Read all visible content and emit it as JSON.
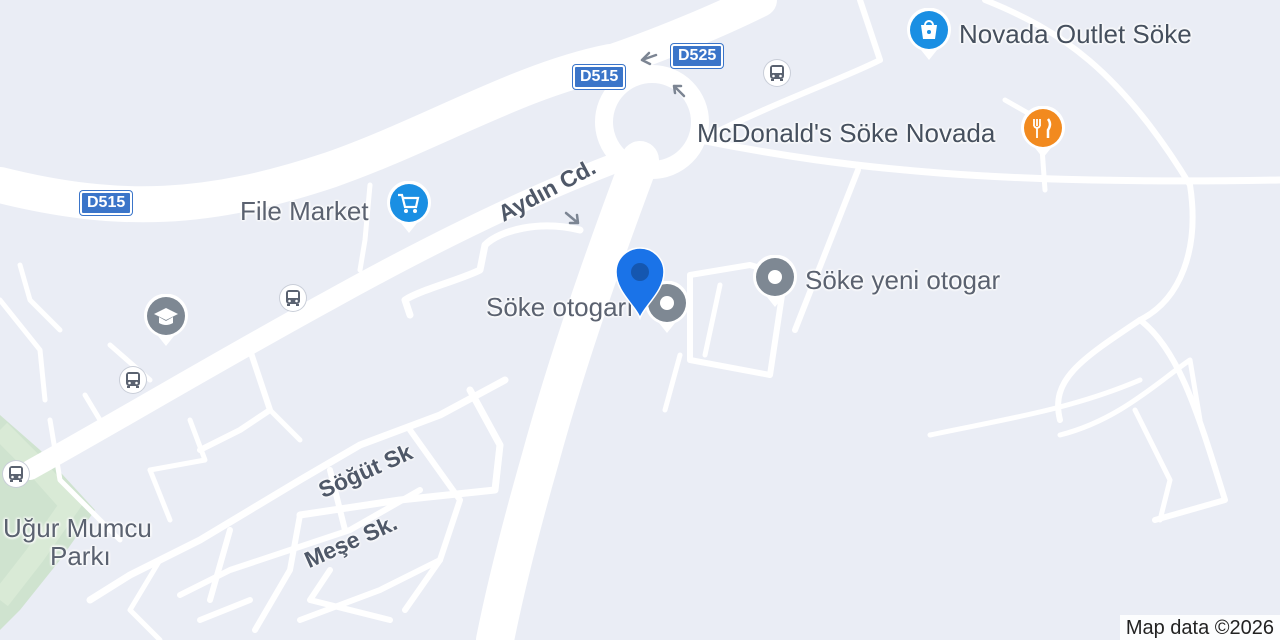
{
  "map": {
    "places": {
      "novada_outlet": "Novada Outlet Söke",
      "mcdonalds": "McDonald's Söke Novada",
      "file_market": "File Market",
      "soke_otogar": "Söke otogarı",
      "soke_yeni_otogar": "Söke yeni otogar",
      "ugur_mumcu_line1": "Uğur Mumcu",
      "ugur_mumcu_line2": "Parkı"
    },
    "roads": {
      "aydin": "Aydın Cd.",
      "sogut": "Söğüt Sk",
      "mese": "Meşe Sk."
    },
    "shields": {
      "d515_top": "D515",
      "d525": "D525",
      "d515_left": "D515"
    },
    "icons": {
      "shopping": "shopping-bag-icon",
      "restaurant": "fork-knife-icon",
      "cart": "shopping-cart-icon",
      "education": "graduation-cap-icon",
      "generic": "generic-place-icon",
      "bus": "bus-stop-icon",
      "location": "location-pin-icon"
    },
    "colors": {
      "background": "#eaedf5",
      "road": "#ffffff",
      "park": "#cfe3cf",
      "shield": "#3b75c9",
      "shop_pin": "#1a8fe3",
      "food_pin": "#f28a1f",
      "grey_pin": "#7e8893",
      "selected_pin": "#1a73e8"
    },
    "attribution": "Map data ©2026"
  }
}
